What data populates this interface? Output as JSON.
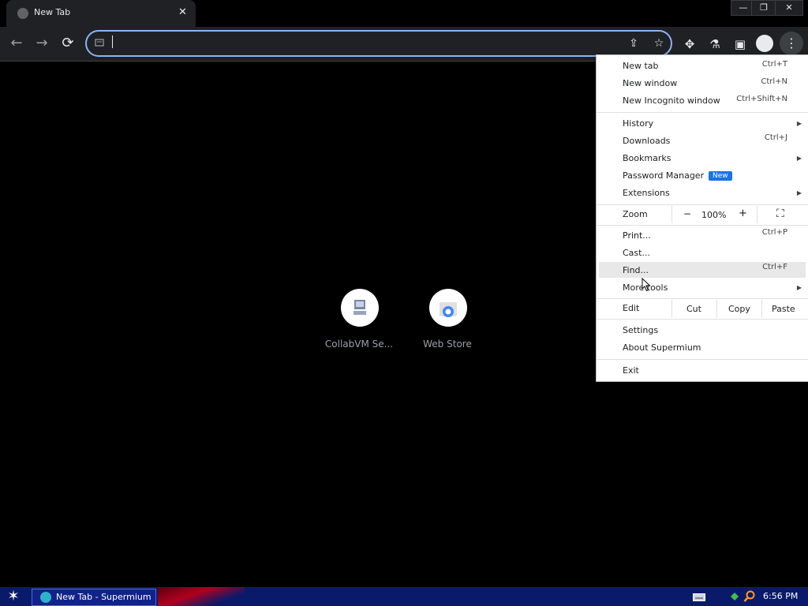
{
  "tab": {
    "title": "New Tab",
    "close_glyph": "✕"
  },
  "window_controls": {
    "minimize": "—",
    "restore": "❐",
    "close": "✕"
  },
  "toolbar": {
    "back_glyph": "←",
    "forward_glyph": "→",
    "reload_glyph": "⟳",
    "share_glyph": "⇪",
    "star_glyph": "☆",
    "extensions_glyph": "✥",
    "labs_glyph": "⚗",
    "sidepanel_glyph": "▣",
    "menu_glyph": "⋮"
  },
  "shortcuts": [
    {
      "label": "CollabVM Se..."
    },
    {
      "label": "Web Store"
    }
  ],
  "menu": {
    "new_tab": {
      "label": "New tab",
      "shortcut": "Ctrl+T"
    },
    "new_window": {
      "label": "New window",
      "shortcut": "Ctrl+N"
    },
    "new_incognito": {
      "label": "New Incognito window",
      "shortcut": "Ctrl+Shift+N"
    },
    "history": {
      "label": "History"
    },
    "downloads": {
      "label": "Downloads",
      "shortcut": "Ctrl+J"
    },
    "bookmarks": {
      "label": "Bookmarks"
    },
    "password_manager": {
      "label": "Password Manager",
      "badge": "New"
    },
    "extensions": {
      "label": "Extensions"
    },
    "zoom": {
      "label": "Zoom",
      "minus": "−",
      "value": "100%",
      "plus": "+",
      "fullscreen": "⛶"
    },
    "print": {
      "label": "Print...",
      "shortcut": "Ctrl+P"
    },
    "cast": {
      "label": "Cast..."
    },
    "find": {
      "label": "Find...",
      "shortcut": "Ctrl+F"
    },
    "more_tools": {
      "label": "More tools"
    },
    "edit": {
      "label": "Edit",
      "cut": "Cut",
      "copy": "Copy",
      "paste": "Paste"
    },
    "settings": {
      "label": "Settings"
    },
    "about": {
      "label": "About Supermium"
    },
    "exit": {
      "label": "Exit"
    },
    "submenu_arrow": "▶"
  },
  "taskbar": {
    "start_glyph": "✶",
    "task_label": "New Tab - Supermium",
    "time": "6:56 PM"
  },
  "colors": {
    "accent": "#8ab4f8",
    "badge": "#1a73e8",
    "taskbar": "#0a1a6b"
  }
}
